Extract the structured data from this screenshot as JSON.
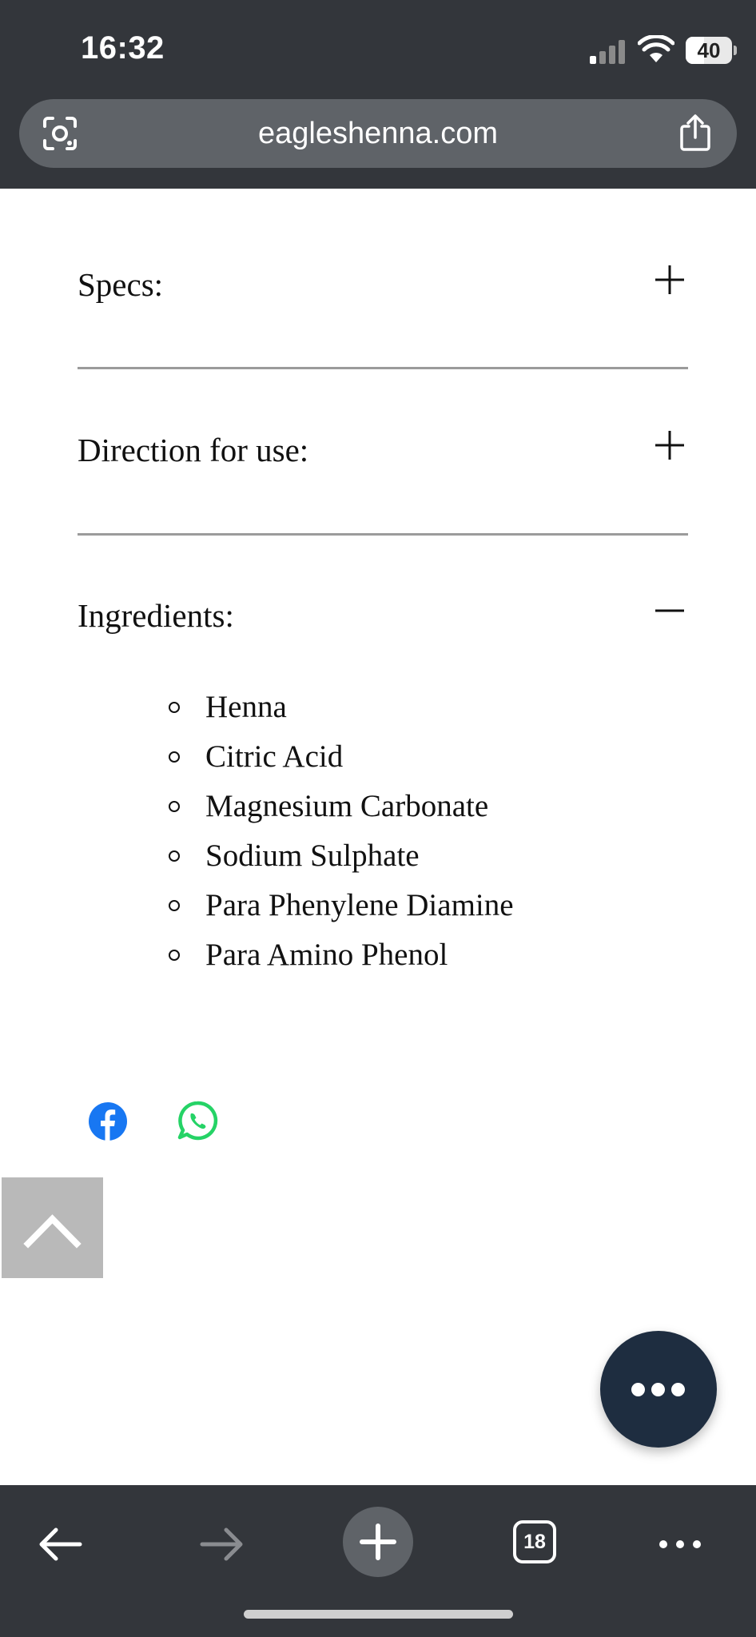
{
  "status_bar": {
    "time": "16:32",
    "battery_level": "40",
    "battery_fraction": 0.4
  },
  "browser": {
    "url": "eagleshenna.com",
    "tab_count": "18"
  },
  "sections": [
    {
      "title": "Specs:",
      "expanded": false
    },
    {
      "title": "Direction for use:",
      "expanded": false
    },
    {
      "title": "Ingredients:",
      "expanded": true
    }
  ],
  "ingredients": [
    "Henna",
    "Citric Acid",
    "Magnesium Carbonate",
    "Sodium Sulphate",
    "Para Phenylene Diamine",
    "Para Amino Phenol"
  ],
  "colors": {
    "chrome_bg": "#33363b",
    "url_pill": "#5f6368",
    "facebook": "#1877f2",
    "whatsapp": "#25d366",
    "fab": "#1e2d40"
  },
  "icons": {
    "share_buttons": [
      "facebook-icon",
      "whatsapp-icon"
    ],
    "toolbar": [
      "back-arrow-icon",
      "forward-arrow-icon",
      "plus-icon",
      "tab-switcher-icon",
      "more-icon"
    ]
  }
}
